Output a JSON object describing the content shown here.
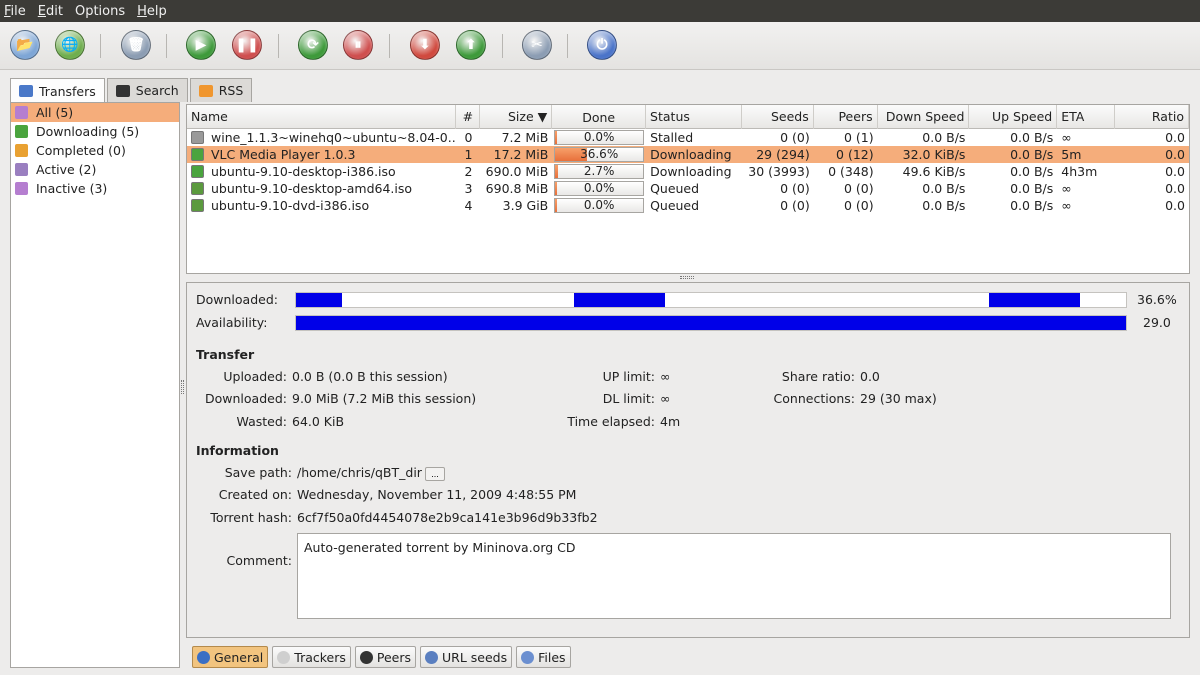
{
  "menu": [
    {
      "key": "F",
      "rest": "ile"
    },
    {
      "key": "E",
      "rest": "dit"
    },
    {
      "key": "",
      "rest": "Options"
    },
    {
      "key": "H",
      "rest": "elp"
    }
  ],
  "toolbar": {
    "buttons": [
      {
        "name": "open-torrent",
        "icon": "folder-icon",
        "glyph": "📂",
        "color": "#7ea6d6"
      },
      {
        "name": "add-url",
        "icon": "globe-icon",
        "glyph": "🌐",
        "color": "#6fae4e"
      },
      {
        "name": "delete",
        "icon": "trash-icon",
        "glyph": "🗑",
        "color": "#8c9db3"
      },
      {
        "name": "start",
        "icon": "play-icon",
        "glyph": "▶",
        "color": "#3e9a3b"
      },
      {
        "name": "pause",
        "icon": "pause-icon",
        "glyph": "❚❚",
        "color": "#cf4f4f"
      },
      {
        "name": "start-all",
        "icon": "start-all-icon",
        "glyph": "⟳",
        "color": "#3e9a3b"
      },
      {
        "name": "pause-all",
        "icon": "pause-all-icon",
        "glyph": "⏸",
        "color": "#cf4f4f"
      },
      {
        "name": "decrease-priority",
        "icon": "arrow-down-icon",
        "glyph": "⬇",
        "color": "#d04a3f"
      },
      {
        "name": "increase-priority",
        "icon": "arrow-up-icon",
        "glyph": "⬆",
        "color": "#3e9a3b"
      },
      {
        "name": "options",
        "icon": "tools-icon",
        "glyph": "✂",
        "color": "#8c9db3"
      },
      {
        "name": "exit",
        "icon": "power-icon",
        "glyph": "⏻",
        "color": "#4b74c9"
      }
    ]
  },
  "left_tabs": [
    {
      "label": "Transfers",
      "icon": "transfers-icon"
    },
    {
      "label": "Search",
      "icon": "binoculars-icon"
    },
    {
      "label": "RSS",
      "icon": "rss-icon"
    }
  ],
  "filters": [
    {
      "label": "All (5)",
      "icon": "all-icon",
      "color": "#b57ed0"
    },
    {
      "label": "Downloading (5)",
      "icon": "downloading-icon",
      "color": "#4aa43e"
    },
    {
      "label": "Completed (0)",
      "icon": "completed-icon",
      "color": "#e9a132"
    },
    {
      "label": "Active (2)",
      "icon": "active-icon",
      "color": "#9a7fc0"
    },
    {
      "label": "Inactive (3)",
      "icon": "inactive-icon",
      "color": "#b57ed0"
    }
  ],
  "columns": [
    "Name",
    "#",
    "Size ▼",
    "Done",
    "Status",
    "Seeds",
    "Peers",
    "Down Speed",
    "Up Speed",
    "ETA",
    "Ratio"
  ],
  "torrents": [
    {
      "name": "wine_1.1.3~winehq0~ubuntu~8.04-0...",
      "num": "0",
      "size": "7.2 MiB",
      "done": "0.0%",
      "done_pct": 2,
      "status": "Stalled",
      "seeds": "0 (0)",
      "peers": "0 (1)",
      "down": "0.0 B/s",
      "up": "0.0 B/s",
      "eta": "∞",
      "ratio": "0.0",
      "icon": "stalled-icon",
      "icolor": "#9a9a9a",
      "selected": false
    },
    {
      "name": "VLC Media Player 1.0.3",
      "num": "1",
      "size": "17.2 MiB",
      "done": "36.6%",
      "done_pct": 36.6,
      "status": "Downloading",
      "seeds": "29 (294)",
      "peers": "0 (12)",
      "down": "32.0 KiB/s",
      "up": "0.0 B/s",
      "eta": "5m",
      "ratio": "0.0",
      "icon": "downloading-icon",
      "icolor": "#4aa43e",
      "selected": true
    },
    {
      "name": "ubuntu-9.10-desktop-i386.iso",
      "num": "2",
      "size": "690.0 MiB",
      "done": "2.7%",
      "done_pct": 2.7,
      "status": "Downloading",
      "seeds": "30 (3993)",
      "peers": "0 (348)",
      "down": "49.6 KiB/s",
      "up": "0.0 B/s",
      "eta": "4h3m",
      "ratio": "0.0",
      "icon": "downloading-icon",
      "icolor": "#4aa43e",
      "selected": false
    },
    {
      "name": "ubuntu-9.10-desktop-amd64.iso",
      "num": "3",
      "size": "690.8 MiB",
      "done": "0.0%",
      "done_pct": 2,
      "status": "Queued",
      "seeds": "0 (0)",
      "peers": "0 (0)",
      "down": "0.0 B/s",
      "up": "0.0 B/s",
      "eta": "∞",
      "ratio": "0.0",
      "icon": "queued-icon",
      "icolor": "#5b9a3e",
      "selected": false
    },
    {
      "name": "ubuntu-9.10-dvd-i386.iso",
      "num": "4",
      "size": "3.9 GiB",
      "done": "0.0%",
      "done_pct": 2,
      "status": "Queued",
      "seeds": "0 (0)",
      "peers": "0 (0)",
      "down": "0.0 B/s",
      "up": "0.0 B/s",
      "eta": "∞",
      "ratio": "0.0",
      "icon": "queued-icon",
      "icolor": "#5b9a3e",
      "selected": false
    }
  ],
  "details": {
    "downloaded_label": "Downloaded:",
    "downloaded_value": "36.6%",
    "downloaded_pieces": [
      [
        0.0,
        0.055
      ],
      [
        0.335,
        0.445
      ],
      [
        0.835,
        0.945
      ]
    ],
    "availability_label": "Availability:",
    "availability_value": "29.0",
    "availability_level": 1.0,
    "transfer_title": "Transfer",
    "uploaded_label": "Uploaded:",
    "uploaded_value": "0.0 B (0.0 B this session)",
    "downloaded2_label": "Downloaded:",
    "downloaded2_value": "9.0 MiB (7.2 MiB this session)",
    "wasted_label": "Wasted:",
    "wasted_value": "64.0 KiB",
    "up_limit_label": "UP limit:",
    "up_limit_value": "∞",
    "dl_limit_label": "DL limit:",
    "dl_limit_value": "∞",
    "time_elapsed_label": "Time elapsed:",
    "time_elapsed_value": "4m",
    "share_ratio_label": "Share ratio:",
    "share_ratio_value": "0.0",
    "connections_label": "Connections:",
    "connections_value": "29 (30 max)",
    "information_title": "Information",
    "save_path_label": "Save path:",
    "save_path_value": "/home/chris/qBT_dir",
    "browse_label": "...",
    "created_on_label": "Created on:",
    "created_on_value": "Wednesday, November 11, 2009 4:48:55 PM",
    "hash_label": "Torrent hash:",
    "hash_value": "6cf7f50a0fd4454078e2b9ca141e3b96d9b33fb2",
    "comment_label": "Comment:",
    "comment_value": "Auto-generated torrent by Mininova.org CD"
  },
  "bottom_tabs": [
    {
      "label": "General",
      "icon": "info-icon",
      "color": "#3b6fc4",
      "active": true
    },
    {
      "label": "Trackers",
      "icon": "trackers-icon",
      "color": "#cfcfcf",
      "active": false
    },
    {
      "label": "Peers",
      "icon": "peers-icon",
      "color": "#333333",
      "active": false
    },
    {
      "label": "URL seeds",
      "icon": "url-seeds-icon",
      "color": "#5a7fc0",
      "active": false
    },
    {
      "label": "Files",
      "icon": "files-icon",
      "color": "#6b8fd0",
      "active": false
    }
  ]
}
